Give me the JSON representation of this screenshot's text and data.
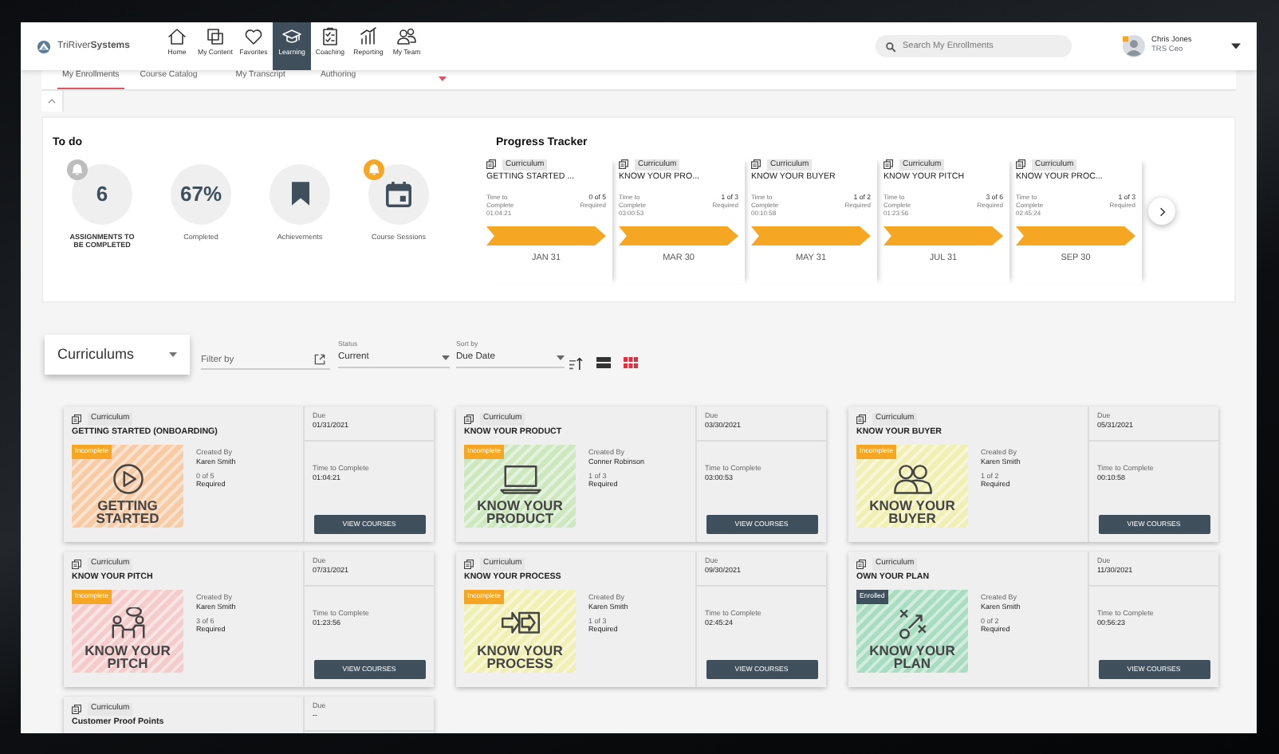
{
  "logo": {
    "text": "TriRiver**Systems**"
  },
  "nav": [
    {
      "label": "Home",
      "kind": "home",
      "selected": false
    },
    {
      "label": "My Content",
      "kind": "content",
      "selected": false
    },
    {
      "label": "Favorites",
      "kind": "heart",
      "selected": false
    },
    {
      "label": "Learning",
      "kind": "cap",
      "selected": true
    },
    {
      "label": "Coaching",
      "kind": "clipboard",
      "selected": false
    },
    {
      "label": "Reporting",
      "kind": "chart",
      "selected": false
    },
    {
      "label": "My Team",
      "kind": "team",
      "selected": false
    }
  ],
  "search": {
    "placeholder": "Search My Enrollments"
  },
  "user": {
    "name": "Chris Jones",
    "role": "TRS Ceo"
  },
  "tabs": [
    {
      "label": "My Enrollments",
      "selected": true
    },
    {
      "label": "Course Catalog",
      "selected": false
    },
    {
      "label": "My Transcript",
      "selected": false
    },
    {
      "label": "Authoring",
      "selected": false,
      "dropdown": true
    }
  ],
  "todo": {
    "title": "To do",
    "items": [
      {
        "kind": "number",
        "value": "6",
        "label": "ASSIGNMENTS TO BE COMPLETED",
        "bell": {
          "color": "#bdbdbd"
        }
      },
      {
        "kind": "number",
        "value": "67%",
        "label": "Completed"
      },
      {
        "kind": "bookmark",
        "label": "Achievements"
      },
      {
        "kind": "calendar",
        "label": "Course Sessions",
        "bell": {
          "color": "#f5a623"
        }
      }
    ]
  },
  "tracker": {
    "title": "Progress Tracker",
    "items": [
      {
        "tag": "Curriculum",
        "title": "GETTING STARTED ...",
        "time_label": "Time to Complete",
        "time": "01:04:21",
        "count": "0 of 5",
        "required": "Required",
        "date": "JAN 31"
      },
      {
        "tag": "Curriculum",
        "title": "KNOW YOUR PRO...",
        "time_label": "Time to Complete",
        "time": "03:00:53",
        "count": "1 of 3",
        "required": "Required",
        "date": "MAR 30"
      },
      {
        "tag": "Curriculum",
        "title": "KNOW YOUR BUYER",
        "time_label": "Time to Complete",
        "time": "00:10:58",
        "count": "1 of 2",
        "required": "Required",
        "date": "MAY 31"
      },
      {
        "tag": "Curriculum",
        "title": "KNOW YOUR PITCH",
        "time_label": "Time to Complete",
        "time": "01:23:56",
        "count": "3 of 6",
        "required": "Required",
        "date": "JUL 31"
      },
      {
        "tag": "Curriculum",
        "title": "KNOW YOUR PROC...",
        "time_label": "Time to Complete",
        "time": "02:45:24",
        "count": "1 of 3",
        "required": "Required",
        "date": "SEP 30"
      }
    ]
  },
  "filters": {
    "collection": "Curriculums",
    "filter_placeholder": "Filter by",
    "status": {
      "label": "Status",
      "value": "Current"
    },
    "sort": {
      "label": "Sort by",
      "value": "Due Date"
    },
    "views": [
      {
        "kind": "list",
        "selected": false
      },
      {
        "kind": "grid",
        "selected": true
      }
    ]
  },
  "cards": [
    {
      "tag": "Curriculum",
      "title": "GETTING STARTED (ONBOARDING)",
      "art": {
        "kind": "play",
        "color": "#f6cba5",
        "text": "GETTING STARTED",
        "badge": {
          "label": "Incomplete",
          "color": "#f5a623"
        }
      },
      "created_label": "Created By",
      "author": "Karen Smith",
      "count": "0 of 5",
      "required": "Required",
      "due_label": "Due",
      "due": "01/31/2021",
      "time_label": "Time to Complete",
      "time": "01:04:21",
      "button": "VIEW COURSES"
    },
    {
      "tag": "Curriculum",
      "title": "KNOW YOUR PRODUCT",
      "art": {
        "kind": "laptop",
        "color": "#cde8bf",
        "text": "KNOW YOUR PRODUCT",
        "badge": {
          "label": "Incomplete",
          "color": "#f5a623"
        }
      },
      "created_label": "Created By",
      "author": "Conner Robinson",
      "count": "1 of 3",
      "required": "Required",
      "due_label": "Due",
      "due": "03/30/2021",
      "time_label": "Time to Complete",
      "time": "03:00:53",
      "button": "VIEW COURSES"
    },
    {
      "tag": "Curriculum",
      "title": "KNOW YOUR BUYER",
      "art": {
        "kind": "people",
        "color": "#f1f0b4",
        "text": "KNOW YOUR BUYER",
        "badge": {
          "label": "Incomplete",
          "color": "#f5a623"
        }
      },
      "created_label": "Created By",
      "author": "Karen Smith",
      "count": "1 of 2",
      "required": "Required",
      "due_label": "Due",
      "due": "05/31/2021",
      "time_label": "Time to Complete",
      "time": "00:10:58",
      "button": "VIEW COURSES"
    },
    {
      "tag": "Curriculum",
      "title": "KNOW YOUR PITCH",
      "art": {
        "kind": "meeting",
        "color": "#f4cccc",
        "text": "KNOW YOUR PITCH",
        "badge": {
          "label": "Incomplete",
          "color": "#f5a623"
        }
      },
      "created_label": "Created By",
      "author": "Karen Smith",
      "count": "3 of 6",
      "required": "Required",
      "due_label": "Due",
      "due": "07/31/2021",
      "time_label": "Time to Complete",
      "time": "01:23:56",
      "button": "VIEW COURSES"
    },
    {
      "tag": "Curriculum",
      "title": "KNOW YOUR PROCESS",
      "art": {
        "kind": "arrows",
        "color": "#f1f0b4",
        "text": "KNOW YOUR PROCESS",
        "badge": {
          "label": "Incomplete",
          "color": "#f5a623"
        }
      },
      "created_label": "Created By",
      "author": "Karen Smith",
      "count": "1 of 3",
      "required": "Required",
      "due_label": "Due",
      "due": "09/30/2021",
      "time_label": "Time to Complete",
      "time": "02:45:24",
      "button": "VIEW COURSES"
    },
    {
      "tag": "Curriculum",
      "title": "OWN YOUR PLAN",
      "art": {
        "kind": "strategy",
        "color": "#a9dcc0",
        "text": "KNOW YOUR PLAN",
        "badge": {
          "label": "Enrolled",
          "color": "#3f505c"
        }
      },
      "created_label": "Created By",
      "author": "Karen Smith",
      "count": "0 of 2",
      "required": "Required",
      "due_label": "Due",
      "due": "11/30/2021",
      "time_label": "Time to Complete",
      "time": "00:56:23",
      "button": "VIEW COURSES"
    },
    {
      "tag": "Curriculum",
      "title": "Customer Proof Points",
      "due_label": "Due",
      "due": "--"
    }
  ]
}
